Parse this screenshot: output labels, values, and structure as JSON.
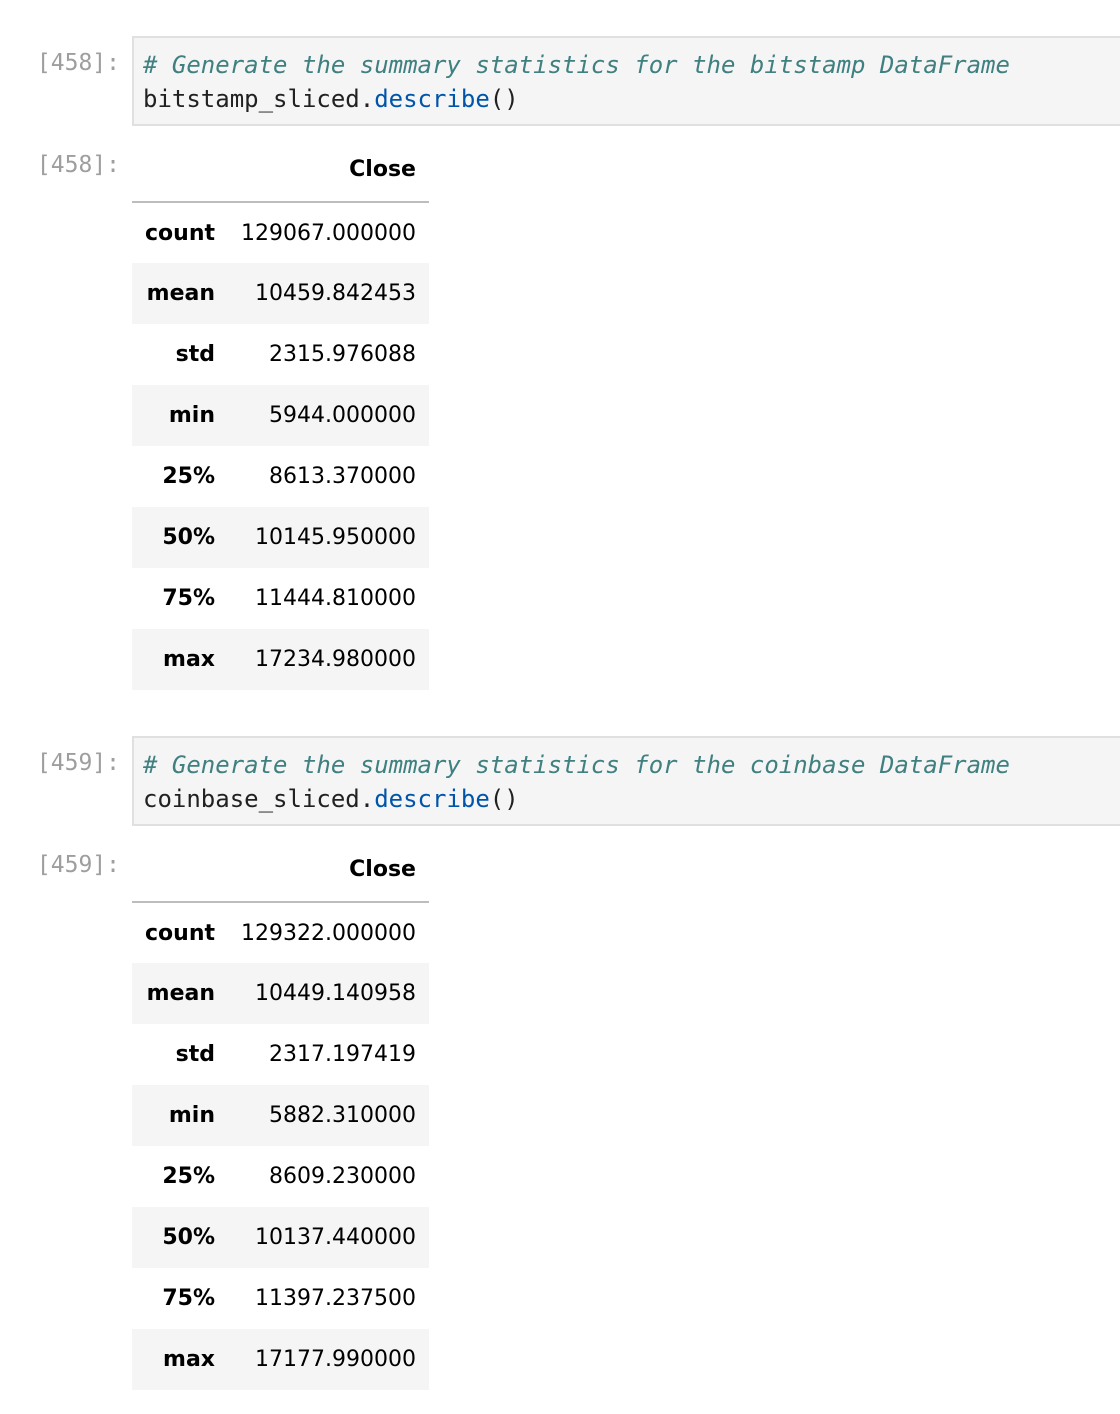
{
  "cells": [
    {
      "input_prompt": "[458]:",
      "code_comment": "# Generate the summary statistics for the bitstamp DataFrame",
      "code_object": "bitstamp_sliced",
      "code_dot": ".",
      "code_method": "describe",
      "code_parens": "()",
      "output_prompt": "[458]:",
      "table": {
        "header_blank": "",
        "column": "Close",
        "rows": [
          {
            "label": "count",
            "value": "129067.000000"
          },
          {
            "label": "mean",
            "value": "10459.842453"
          },
          {
            "label": "std",
            "value": "2315.976088"
          },
          {
            "label": "min",
            "value": "5944.000000"
          },
          {
            "label": "25%",
            "value": "8613.370000"
          },
          {
            "label": "50%",
            "value": "10145.950000"
          },
          {
            "label": "75%",
            "value": "11444.810000"
          },
          {
            "label": "max",
            "value": "17234.980000"
          }
        ]
      }
    },
    {
      "input_prompt": "[459]:",
      "code_comment": "# Generate the summary statistics for the coinbase DataFrame",
      "code_object": "coinbase_sliced",
      "code_dot": ".",
      "code_method": "describe",
      "code_parens": "()",
      "output_prompt": "[459]:",
      "table": {
        "header_blank": "",
        "column": "Close",
        "rows": [
          {
            "label": "count",
            "value": "129322.000000"
          },
          {
            "label": "mean",
            "value": "10449.140958"
          },
          {
            "label": "std",
            "value": "2317.197419"
          },
          {
            "label": "min",
            "value": "5882.310000"
          },
          {
            "label": "25%",
            "value": "8609.230000"
          },
          {
            "label": "50%",
            "value": "10137.440000"
          },
          {
            "label": "75%",
            "value": "11397.237500"
          },
          {
            "label": "max",
            "value": "17177.990000"
          }
        ]
      }
    }
  ],
  "colors": {
    "prompt": "#9e9e9e",
    "comment": "#408080",
    "method": "#0055aa",
    "code_bg": "#f5f5f5"
  }
}
